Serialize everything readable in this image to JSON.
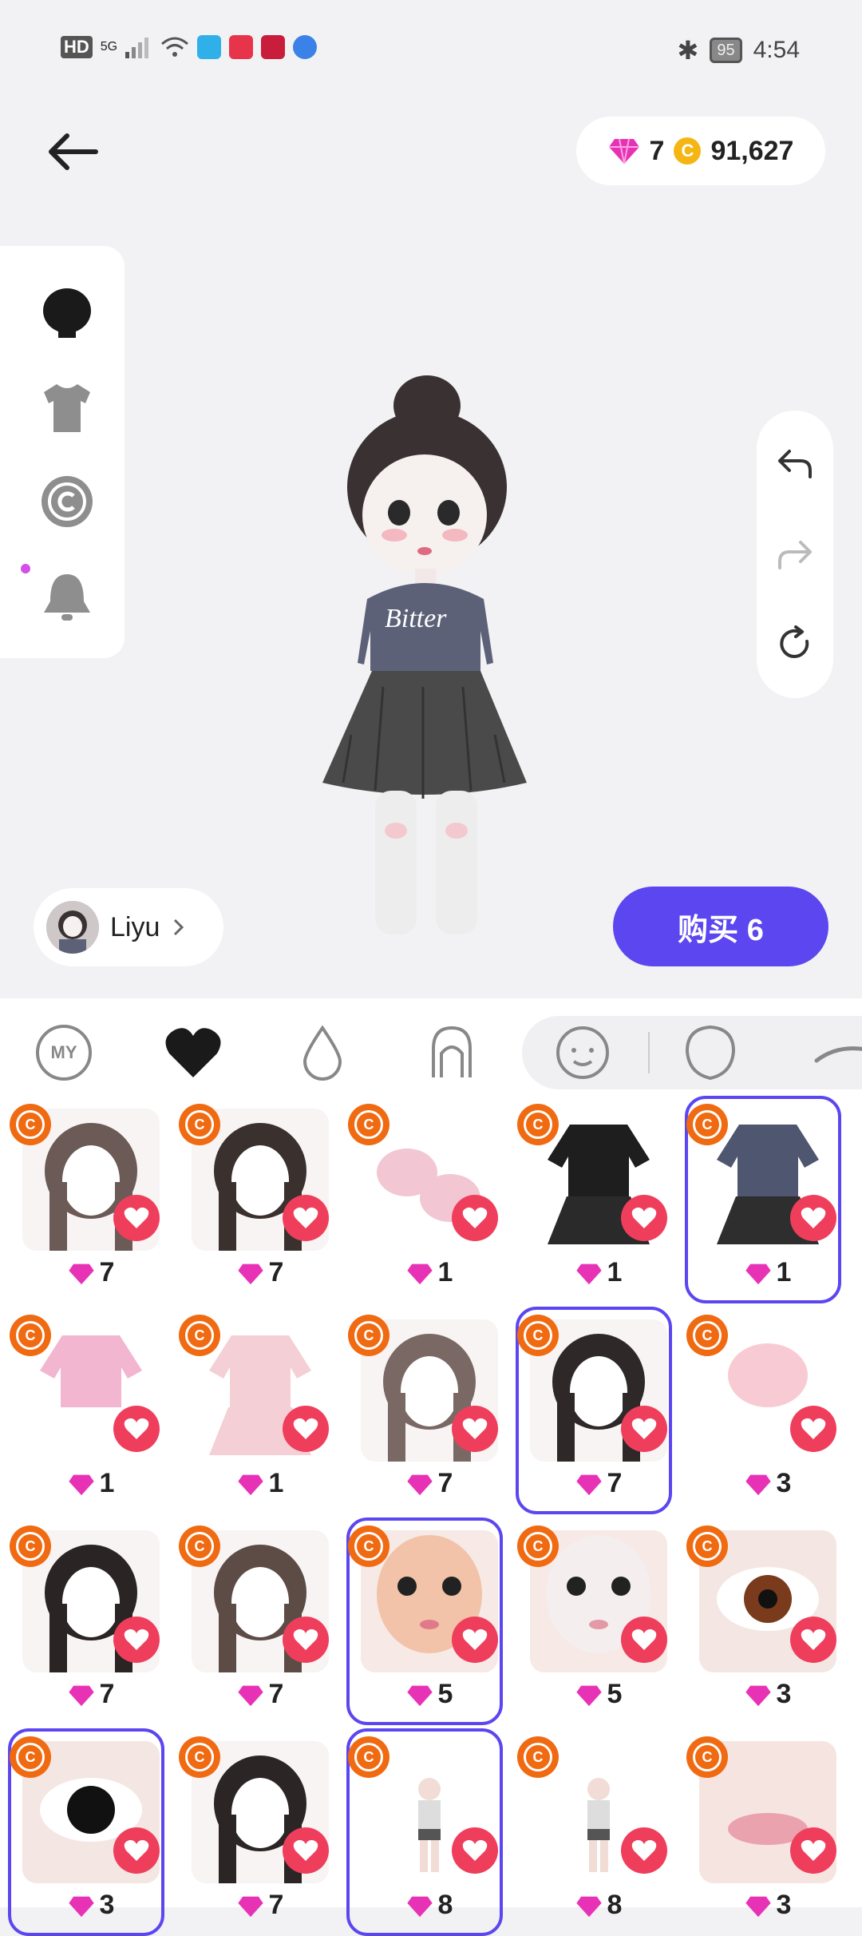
{
  "status_bar": {
    "left_labels": [
      "HD",
      "5G"
    ],
    "battery": "95",
    "time": "4:54"
  },
  "header": {
    "gems": "7",
    "coins": "91,627"
  },
  "profile": {
    "name": "Liyu"
  },
  "buy_button": {
    "label": "购买 6"
  },
  "tabs": {
    "my_label": "MY"
  },
  "colors": {
    "accent": "#5b46f0",
    "heart": "#ef3e5c",
    "badge": "#f06a12",
    "gem": "#e832b6"
  },
  "items": [
    {
      "price": "7",
      "thumb": "hair-bun",
      "selected": false
    },
    {
      "price": "7",
      "thumb": "hair-long-dark",
      "selected": false
    },
    {
      "price": "1",
      "thumb": "shoes-pink",
      "selected": false
    },
    {
      "price": "1",
      "thumb": "dress-black-pink",
      "selected": false
    },
    {
      "price": "1",
      "thumb": "outfit-bitter",
      "selected": true
    },
    {
      "price": "1",
      "thumb": "outfit-pink-sweater",
      "selected": false
    },
    {
      "price": "1",
      "thumb": "dress-pink",
      "selected": false
    },
    {
      "price": "7",
      "thumb": "hair-twintail",
      "selected": false
    },
    {
      "price": "7",
      "thumb": "hair-top-bun",
      "selected": true
    },
    {
      "price": "3",
      "thumb": "blush",
      "selected": false
    },
    {
      "price": "7",
      "thumb": "hair-long-wavy",
      "selected": false
    },
    {
      "price": "7",
      "thumb": "hair-short-curl",
      "selected": false
    },
    {
      "price": "5",
      "thumb": "face-cute",
      "selected": true
    },
    {
      "price": "5",
      "thumb": "face-pale",
      "selected": false
    },
    {
      "price": "3",
      "thumb": "eye-brown",
      "selected": false
    },
    {
      "price": "3",
      "thumb": "eye-black",
      "selected": true
    },
    {
      "price": "7",
      "thumb": "hair-long-black",
      "selected": false
    },
    {
      "price": "8",
      "thumb": "body-base",
      "selected": true
    },
    {
      "price": "8",
      "thumb": "body-base-small",
      "selected": false
    },
    {
      "price": "3",
      "thumb": "lips-pink",
      "selected": false
    }
  ]
}
